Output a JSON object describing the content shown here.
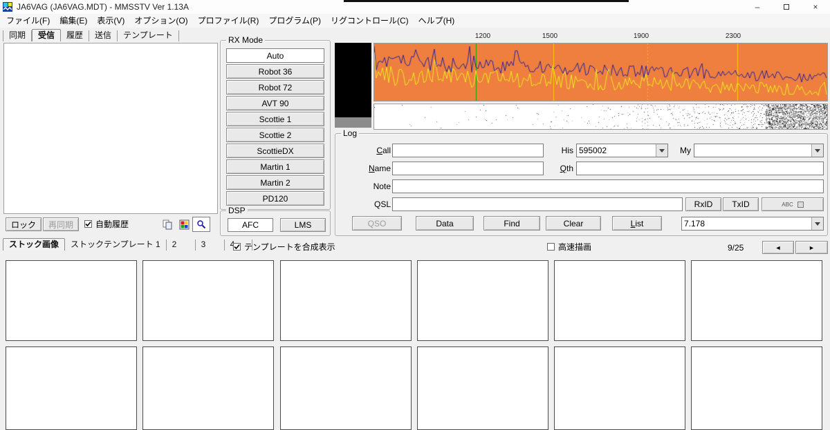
{
  "titlebar": {
    "title": "JA6VAG (JA6VAG.MDT) - MMSSTV Ver 1.13A",
    "minimize_glyph": "–",
    "close_glyph": "×"
  },
  "menubar": {
    "items": [
      "ファイル(F)",
      "編集(E)",
      "表示(V)",
      "オプション(O)",
      "プロファイル(R)",
      "プログラム(P)",
      "リグコントロール(C)",
      "ヘルプ(H)"
    ]
  },
  "main_tabs": {
    "items": [
      "同期",
      "受信",
      "履歴",
      "送信",
      "テンプレート"
    ],
    "active": "受信"
  },
  "rx_controls": {
    "lock_label": "ロック",
    "resync_label": "再同期",
    "auto_history_label": "自動履歴",
    "auto_history_checked": true
  },
  "rx_mode": {
    "group_label": "RX Mode",
    "buttons": [
      "Auto",
      "Robot 36",
      "Robot 72",
      "AVT 90",
      "Scottie 1",
      "Scottie 2",
      "ScottieDX",
      "Martin 1",
      "Martin 2",
      "PD120"
    ],
    "active": "Auto"
  },
  "dsp": {
    "group_label": "DSP",
    "afc_label": "AFC",
    "lms_label": "LMS",
    "active": "AFC"
  },
  "spectrum": {
    "freq_labels": [
      "1200",
      "1500",
      "1900",
      "2300"
    ],
    "bg_color": "#ee7f3e",
    "trace_colors": [
      "#2a22a0",
      "#f0ec20"
    ],
    "marker_green": "#00b000",
    "marker_yellow": "#ffd000",
    "marker_dotted": "#ffb24d"
  },
  "log": {
    "group_label": "Log",
    "call_label": "Call",
    "call_value": "",
    "name_label": "Name",
    "name_value": "",
    "note_label": "Note",
    "note_value": "",
    "qsl_label": "QSL",
    "qsl_value": "",
    "his_label": "His",
    "his_value": "595002",
    "my_label": "My",
    "my_value": "",
    "qth_label": "Qth",
    "qth_value": "",
    "qso_label": "QSO",
    "data_label": "Data",
    "find_label": "Find",
    "clear_label": "Clear",
    "list_label": "List",
    "rxid_label": "RxID",
    "txid_label": "TxID",
    "abc_label": "ABC",
    "freq_value": "7.178"
  },
  "stock_tabs": {
    "items": [
      "ストック画像",
      "ストックテンプレート 1",
      "2",
      "3",
      "4"
    ],
    "active": "ストック画像"
  },
  "options_row": {
    "template_overlay_label": "テンプレートを合成表示",
    "template_overlay_checked": true,
    "fast_draw_label": "高速描画",
    "fast_draw_checked": false,
    "page_indicator": "9/25",
    "prev_glyph": "◄",
    "next_glyph": "►"
  }
}
